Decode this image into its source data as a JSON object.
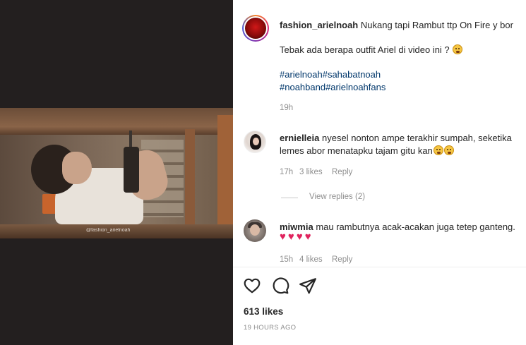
{
  "media": {
    "watermark": "@fashion_arielnoah"
  },
  "caption": {
    "username": "fashion_arielnoah",
    "text": "Nukang tapi Rambut ttp On Fire y bor",
    "line2": "Tebak ada berapa outfit Ariel di video ini ?",
    "hashtags_line1": "#arielnoah#sahabatnoah",
    "hashtags_line2": "#noahband#arielnoahfans",
    "time": "19h"
  },
  "comments": [
    {
      "username": "ernielleia",
      "text_line1": "nyesel nonton ampe terakhir sumpah, seketika",
      "text_line2": "lemes abor menatapku tajam gitu kan",
      "time": "17h",
      "likes": "3 likes",
      "reply": "Reply",
      "view_replies": "View replies (2)"
    },
    {
      "username": "miwmia",
      "text": "mau rambutnya acak-acakan juga tetep ganteng.",
      "hearts": "♥♥♥♥",
      "time": "15h",
      "likes": "4 likes",
      "reply": "Reply"
    }
  ],
  "actions": {
    "icons": [
      "heart-icon",
      "comment-icon",
      "share-icon"
    ]
  },
  "likes": "613 likes",
  "post_time": "19 HOURS AGO",
  "colors": {
    "hashtag": "#00376b",
    "heart": "#e0245e",
    "muted": "#8e8e8e"
  }
}
